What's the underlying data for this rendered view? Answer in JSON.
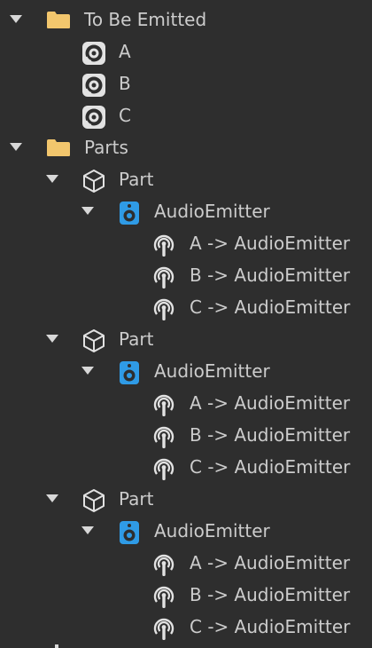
{
  "explorer": {
    "to_be_emitted": {
      "label": "To Be Emitted",
      "icon": "folder-icon",
      "children": [
        {
          "label": "A",
          "icon": "sound-icon"
        },
        {
          "label": "B",
          "icon": "sound-icon"
        },
        {
          "label": "C",
          "icon": "sound-icon"
        }
      ]
    },
    "parts": {
      "label": "Parts",
      "icon": "folder-icon",
      "items": [
        {
          "label": "Part",
          "icon": "part-icon",
          "emitter": {
            "label": "AudioEmitter",
            "icon": "audio-emitter-icon",
            "wires": [
              {
                "label": "A -> AudioEmitter",
                "icon": "wire-icon"
              },
              {
                "label": "B -> AudioEmitter",
                "icon": "wire-icon"
              },
              {
                "label": "C -> AudioEmitter",
                "icon": "wire-icon"
              }
            ]
          }
        },
        {
          "label": "Part",
          "icon": "part-icon",
          "emitter": {
            "label": "AudioEmitter",
            "icon": "audio-emitter-icon",
            "wires": [
              {
                "label": "A -> AudioEmitter",
                "icon": "wire-icon"
              },
              {
                "label": "B -> AudioEmitter",
                "icon": "wire-icon"
              },
              {
                "label": "C -> AudioEmitter",
                "icon": "wire-icon"
              }
            ]
          }
        },
        {
          "label": "Part",
          "icon": "part-icon",
          "emitter": {
            "label": "AudioEmitter",
            "icon": "audio-emitter-icon",
            "wires": [
              {
                "label": "A -> AudioEmitter",
                "icon": "wire-icon"
              },
              {
                "label": "B -> AudioEmitter",
                "icon": "wire-icon"
              },
              {
                "label": "C -> AudioEmitter",
                "icon": "wire-icon"
              }
            ]
          }
        }
      ]
    },
    "colors": {
      "background": "#2e2e2e",
      "text": "#cccccc",
      "folder": "#f2c66d",
      "emitter_blue": "#2f9be6",
      "icon_light": "#e2e2e2"
    }
  }
}
